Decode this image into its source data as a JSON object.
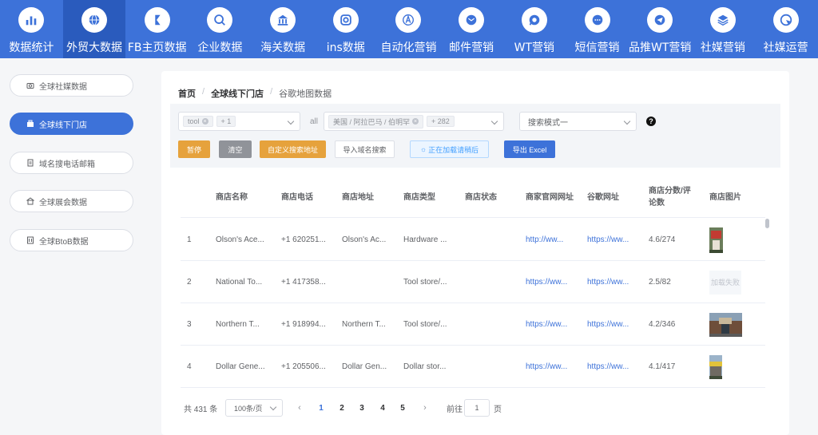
{
  "topnav": {
    "accent": "#3d72d9",
    "items": [
      {
        "label": "数据统计",
        "icon": "bar-chart-icon"
      },
      {
        "label": "外贸大数据",
        "icon": "globe-icon",
        "active": true
      },
      {
        "label": "FB主页数据",
        "icon": "facebook-icon"
      },
      {
        "label": "企业数据",
        "icon": "company-search-icon"
      },
      {
        "label": "海关数据",
        "icon": "customs-building-icon"
      },
      {
        "label": "ins数据",
        "icon": "instagram-icon"
      },
      {
        "label": "自动化营销",
        "icon": "auto-marketing-icon"
      },
      {
        "label": "邮件营销",
        "icon": "email-icon"
      },
      {
        "label": "WT营销",
        "icon": "whatsapp-icon"
      },
      {
        "label": "短信营销",
        "icon": "sms-icon"
      },
      {
        "label": "品推WT营销",
        "icon": "telegram-icon"
      },
      {
        "label": "社媒营销",
        "icon": "layers-icon"
      },
      {
        "label": "社媒运营",
        "icon": "social-ops-icon"
      }
    ]
  },
  "sidebar": {
    "items": [
      {
        "label": "全球社媒数据",
        "icon": "camera-icon"
      },
      {
        "label": "全球线下门店",
        "icon": "store-icon",
        "active": true
      },
      {
        "label": "域名搜电话邮箱",
        "icon": "document-icon"
      },
      {
        "label": "全球展会数据",
        "icon": "exhibition-icon"
      },
      {
        "label": "全球BtoB数据",
        "icon": "building-icon"
      }
    ]
  },
  "breadcrumb": [
    "首页",
    "全球线下门店",
    "谷歌地图数据"
  ],
  "filter": {
    "keyword_tag": "tool",
    "keyword_more": "+ 1",
    "all_label": "all",
    "region_tag": "美国 / 阿拉巴马 / 伯明罕",
    "region_more": "+ 282",
    "mode_value": "搜索模式一",
    "help": "?"
  },
  "buttons": {
    "pause": "暂停",
    "clear": "清空",
    "custom_address": "自定义搜索地址",
    "import_domain": "导入域名搜索",
    "loading": "正在加载请稍后",
    "export": "导出 Excel"
  },
  "table": {
    "columns": [
      "",
      "商店名称",
      "商店电话",
      "商店地址",
      "商店类型",
      "商店状态",
      "商家官网网址",
      "谷歌网址",
      "商店分数/评论数",
      "商店图片"
    ],
    "rows": [
      {
        "index": "1",
        "name": "Olson's Ace...",
        "phone": "+1 620251...",
        "address": "Olson's Ac...",
        "type": "Hardware ...",
        "status": "",
        "website": "http://ww...",
        "google": "https://ww...",
        "rating": "4.6/274",
        "image": "store-photo-red-sign"
      },
      {
        "index": "2",
        "name": "National To...",
        "phone": "+1 417358...",
        "address": "",
        "type": "Tool store/...",
        "status": "",
        "website": "https://ww...",
        "google": "https://ww...",
        "rating": "2.5/82",
        "image_failed": "加载失败"
      },
      {
        "index": "3",
        "name": "Northern T...",
        "phone": "+1 918994...",
        "address": "Northern T...",
        "type": "Tool store/...",
        "status": "",
        "website": "https://ww...",
        "google": "https://ww...",
        "rating": "4.2/346",
        "image": "store-photo-building"
      },
      {
        "index": "4",
        "name": "Dollar Gene...",
        "phone": "+1 205506...",
        "address": "Dollar Gen...",
        "type": "Dollar stor...",
        "status": "",
        "website": "https://ww...",
        "google": "https://ww...",
        "rating": "4.1/417",
        "image": "store-photo-storefront"
      }
    ]
  },
  "pagination": {
    "total": "共 431 条",
    "page_size": "100条/页",
    "pages": [
      "1",
      "2",
      "3",
      "4",
      "5"
    ],
    "current": "1",
    "goto_label": "前往",
    "goto_value": "1",
    "page_suffix": "页"
  }
}
